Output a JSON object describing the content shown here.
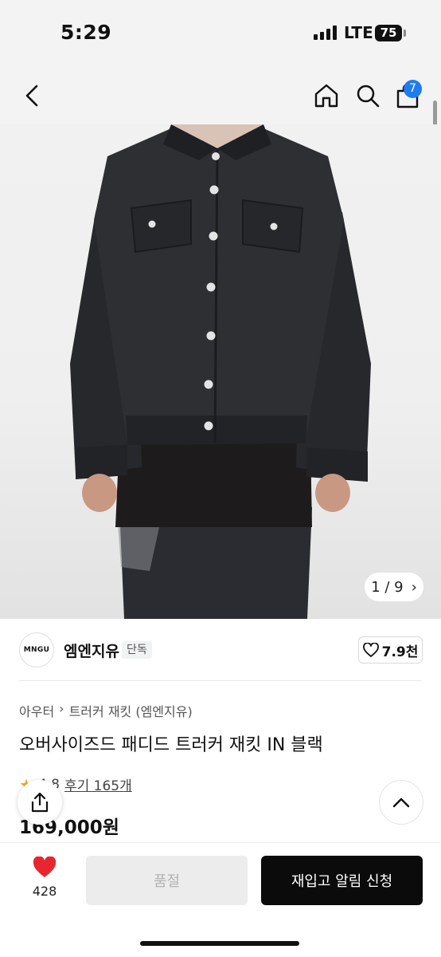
{
  "status_bar": {
    "time": "5:29",
    "network": "LTE",
    "battery": "75"
  },
  "nav": {
    "icons": [
      "back-arrow-icon",
      "home-icon",
      "search-icon",
      "cart-icon"
    ],
    "cart_count": "7"
  },
  "gallery": {
    "current": "1",
    "total": "9",
    "counter": "1 / 9"
  },
  "brand": {
    "logo_text": "MNGU",
    "name": "엠엔지유",
    "badge": "단독",
    "likes": "7.9천"
  },
  "breadcrumb": [
    "아우터",
    "트러커 재킷 (엠엔지유)"
  ],
  "product": {
    "title": "오버사이즈드 패디드 트러커 재킷 IN 블랙",
    "rating": "4.8",
    "reviews": "후기 165개",
    "price": "169,000원"
  },
  "purchase_bar": {
    "wishlist_count": "428",
    "soldout_label": "품절",
    "restock_label": "재입고 알림 신청"
  },
  "colors": {
    "accent": "#1e7bf2",
    "heart": "#e8262f",
    "cta": "#0b0b0b"
  }
}
